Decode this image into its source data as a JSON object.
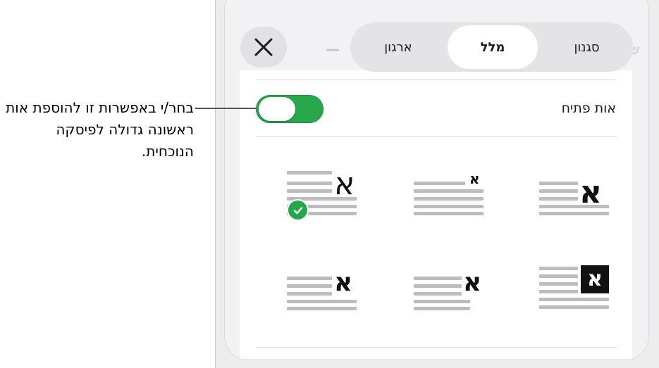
{
  "callout": {
    "text": "בחר/י באפשרות זו להוספת אות ראשונה גדולה לפיסקה הנוכחית."
  },
  "tabs": [
    {
      "label": "סגנון",
      "active": false
    },
    {
      "label": "מלל",
      "active": true
    },
    {
      "label": "ארגון",
      "active": false
    }
  ],
  "background_tabs": {
    "left_minus": "—",
    "right_partial": "שורה"
  },
  "close_icon": "close-icon",
  "drop_cap_row": {
    "label": "אות פתיח",
    "toggle_on": true
  },
  "styles": [
    {
      "glyph": "א",
      "selected": false
    },
    {
      "glyph": "א",
      "selected": false
    },
    {
      "glyph": "א",
      "selected": true
    },
    {
      "glyph": "א",
      "selected": false
    },
    {
      "glyph": "א",
      "selected": false
    },
    {
      "glyph": "א",
      "selected": false
    }
  ],
  "colors": {
    "accent_green": "#26a84b",
    "check_green": "#22a84a"
  }
}
